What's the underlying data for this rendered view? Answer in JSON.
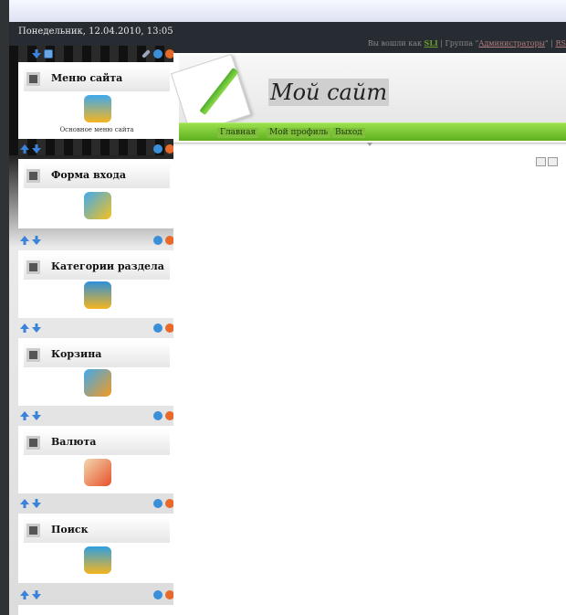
{
  "header": {
    "date": "Понедельник, 12.04.2010, 13:05",
    "login_prefix": "Вы вошли как",
    "username": "SLI",
    "group_sep": "| Группа \"",
    "group": "Администраторы",
    "group_end": "\" |",
    "rss": "RS"
  },
  "site": {
    "title": "Мой сайт",
    "nav": [
      "Главная",
      "Мой профиль",
      "Выход"
    ]
  },
  "sidebar": {
    "blocks": [
      {
        "title": "Меню сайта",
        "caption": "Основное меню сайта",
        "icon": "bell-icon",
        "color": "#f5b51e"
      },
      {
        "title": "Форма входа",
        "caption": "",
        "icon": "key-icon",
        "color": "#f5c21e"
      },
      {
        "title": "Категории раздела",
        "caption": "",
        "icon": "layers-icon",
        "color": "#2e8fd9"
      },
      {
        "title": "Корзина",
        "caption": "",
        "icon": "basket-icon",
        "color": "#f59a1e"
      },
      {
        "title": "Валюта",
        "caption": "",
        "icon": "coins-icon",
        "color": "#e8502a"
      },
      {
        "title": "Поиск",
        "caption": "",
        "icon": "search-icon",
        "color": "#2e9fe0"
      }
    ]
  },
  "colors": {
    "accent_green": "#6fbf2a",
    "sidebar_dark": "#1a1a1a"
  }
}
